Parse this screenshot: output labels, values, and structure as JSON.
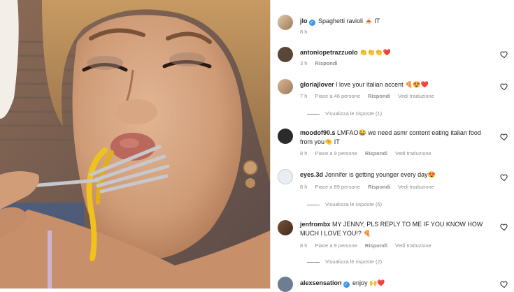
{
  "post": {
    "username": "jlo",
    "caption": "Spaghetti ravioli 🍝 IT",
    "time": "8 h"
  },
  "comments": [
    {
      "username": "antoniopetrazzuolo",
      "text": "👏👏👏❤️",
      "time": "3 h",
      "likes": "",
      "reply": "Rispondi",
      "translate": "",
      "view_replies": ""
    },
    {
      "username": "gloriajlover",
      "text": "I love your italian accent 🍕😍❤️",
      "time": "7 h",
      "likes": "Piace a 46 persone",
      "reply": "Rispondi",
      "translate": "Vedi traduzione",
      "view_replies": "Visualizza le risposte (1)"
    },
    {
      "username": "moodof90.s",
      "text": "LMFAO😂 we need asmr content eating italian food from you🤏 IT",
      "time": "8 h",
      "likes": "Piace a 9 persone",
      "reply": "Rispondi",
      "translate": "Vedi traduzione",
      "view_replies": ""
    },
    {
      "username": "eyes.3d",
      "text": "Jennifer is getting younger every day😍",
      "time": "8 h",
      "likes": "Piace a 89 persone",
      "reply": "Rispondi",
      "translate": "Vedi traduzione",
      "view_replies": "Visualizza le risposte (6)"
    },
    {
      "username": "jenfrombx",
      "text": "MY JENNY, PLS REPLY TO ME IF YOU KNOW HOW MUCH I LOVE YOU!? 🍕",
      "time": "8 h",
      "likes": "Piace a 9 persone",
      "reply": "Rispondi",
      "translate": "Vedi traduzione",
      "view_replies": "Visualizza le risposte (2)"
    },
    {
      "username": "alexsensation",
      "text": "enjoy 🙌❤️",
      "time": "",
      "likes": "",
      "reply": "",
      "translate": "",
      "view_replies": ""
    }
  ],
  "colors": {
    "accent": "#3897f0",
    "heart": "#ed4956",
    "muted": "#8e8e8e",
    "text": "#262626"
  },
  "icons": {
    "verified": "verified-badge-icon",
    "like": "heart-outline-icon"
  }
}
